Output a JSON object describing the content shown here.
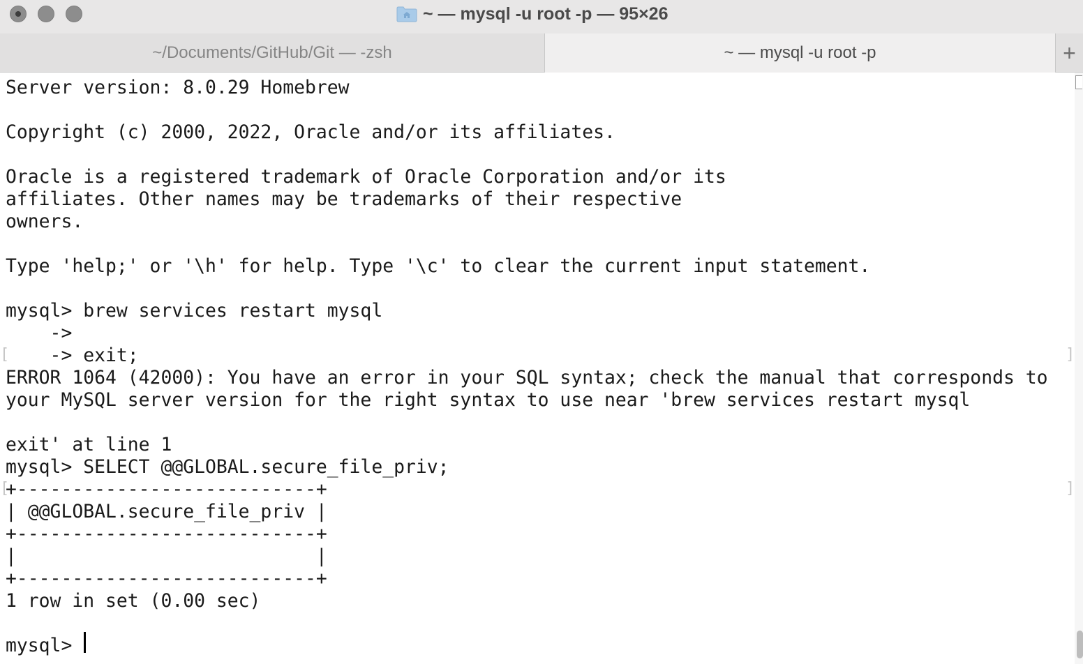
{
  "window": {
    "title": "~ — mysql -u root -p — 95×26",
    "folder_icon": "folder-home-icon"
  },
  "tabs": [
    {
      "label": "~/Documents/GitHub/Git — -zsh",
      "active": false
    },
    {
      "label": "~ — mysql -u root -p",
      "active": true
    }
  ],
  "new_tab_label": "+",
  "terminal": {
    "lines": [
      "Server version: 8.0.29 Homebrew",
      "",
      "Copyright (c) 2000, 2022, Oracle and/or its affiliates.",
      "",
      "Oracle is a registered trademark of Oracle Corporation and/or its",
      "affiliates. Other names may be trademarks of their respective",
      "owners.",
      "",
      "Type 'help;' or '\\h' for help. Type '\\c' to clear the current input statement.",
      "",
      "mysql> brew services restart mysql",
      "    ->",
      "    -> exit;",
      "ERROR 1064 (42000): You have an error in your SQL syntax; check the manual that corresponds to",
      "your MySQL server version for the right syntax to use near 'brew services restart mysql",
      "",
      "exit' at line 1",
      "mysql> SELECT @@GLOBAL.secure_file_priv;",
      "+---------------------------+",
      "| @@GLOBAL.secure_file_priv |",
      "+---------------------------+",
      "|                           |",
      "+---------------------------+",
      "1 row in set (0.00 sec)",
      "",
      "mysql> "
    ]
  },
  "colors": {
    "titlebar": "#e8e7e7",
    "tabbar": "#e1e0e0",
    "text": "#1a1a1a"
  }
}
